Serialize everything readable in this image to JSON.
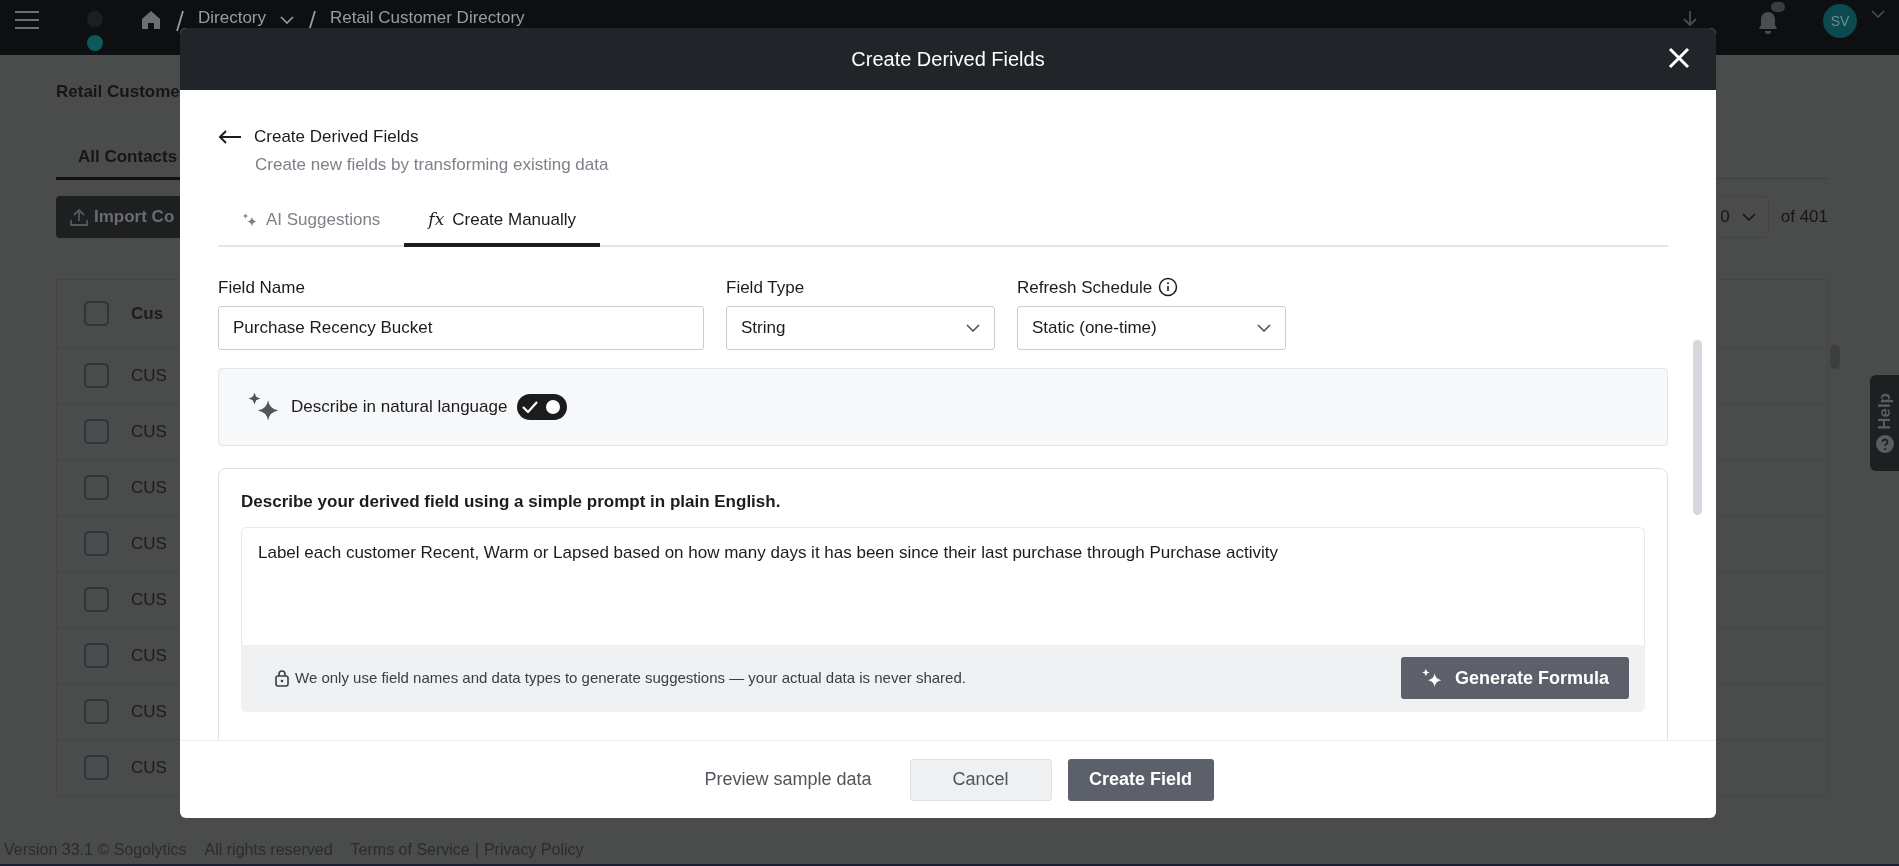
{
  "topbar": {
    "breadcrumbs": [
      {
        "label": "Directory",
        "dropdown": true
      },
      {
        "label": "Retail Customer Directory",
        "dropdown": false
      }
    ],
    "avatar": "SV"
  },
  "background": {
    "page_title": "Retail Custome",
    "tab": "All Contacts",
    "import_button": "Import Co",
    "table_header": {
      "label": "Cus",
      "checked": false
    },
    "rows": [
      {
        "cell": "CUS",
        "checked": false
      },
      {
        "cell": "CUS",
        "checked": false
      },
      {
        "cell": "CUS",
        "checked": false
      },
      {
        "cell": "CUS",
        "checked": false
      },
      {
        "cell": "CUS",
        "checked": false
      },
      {
        "cell": "CUS",
        "checked": false
      },
      {
        "cell": "CUS",
        "checked": false
      },
      {
        "cell": "CUS",
        "checked": false
      }
    ],
    "page_size": "0",
    "page_count": "of 401",
    "help": "Help"
  },
  "footer": {
    "version": "Version 33.1 © Sogolytics",
    "rights": "All rights reserved",
    "links": [
      "Terms of Service",
      "Privacy Policy"
    ],
    "separator": "|"
  },
  "modal": {
    "title": "Create Derived Fields",
    "heading": "Create Derived Fields",
    "subtitle": "Create new fields by transforming existing data",
    "tabs": [
      {
        "label": "AI Suggestions",
        "selected": false,
        "kind": "ai"
      },
      {
        "label": "Create Manually",
        "selected": true,
        "kind": "formula",
        "icon_text": "fx"
      }
    ],
    "fields": [
      {
        "label": "Field Name",
        "value": "Purchase Recency Bucket",
        "kind": "text",
        "info": false
      },
      {
        "label": "Field Type",
        "value": "String",
        "kind": "select",
        "info": false
      },
      {
        "label": "Refresh Schedule",
        "value": "Static (one-time)",
        "kind": "select",
        "info": true
      }
    ],
    "natural_language": {
      "label": "Describe in natural language",
      "on": true
    },
    "prompt": {
      "title": "Describe your derived field using a simple prompt in plain English.",
      "value": "Label each customer Recent, Warm or Lapsed based on how many days it has been since their last purchase through Purchase activity",
      "note": "We only use field names and data types to generate suggestions — your actual data is never shared.",
      "button": "Generate Formula"
    },
    "actions": [
      {
        "label": "Preview sample data",
        "kind": "link"
      },
      {
        "label": "Cancel",
        "kind": "secondary"
      },
      {
        "label": "Create Field",
        "kind": "primary"
      }
    ]
  }
}
